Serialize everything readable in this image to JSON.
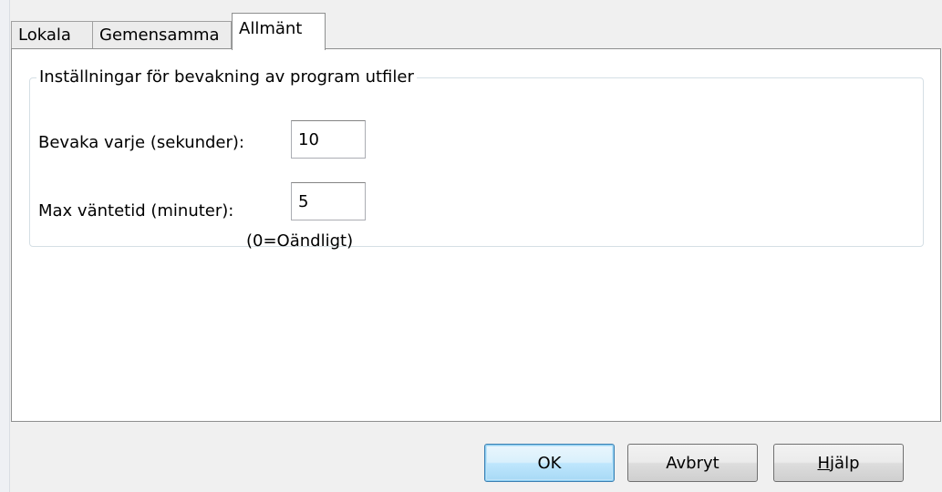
{
  "tabs": [
    {
      "label": "Lokala",
      "active": false
    },
    {
      "label": "Gemensamma",
      "active": false
    },
    {
      "label": "Allmänt",
      "active": true
    }
  ],
  "group": {
    "title": "Inställningar för bevakning av program utfiler",
    "poll": {
      "label": "Bevaka varje (sekunder):",
      "value": "10"
    },
    "max_wait": {
      "label": "Max väntetid (minuter):",
      "value": "5",
      "hint": "(0=Oändligt)"
    }
  },
  "buttons": {
    "ok": "OK",
    "cancel": "Avbryt",
    "help_mnemonic": "H",
    "help_rest": "jälp"
  },
  "colors": {
    "default_button_border": "#3c7fb1",
    "panel_border": "#8e8f8f",
    "groupbox_border": "#d5dfe5"
  }
}
